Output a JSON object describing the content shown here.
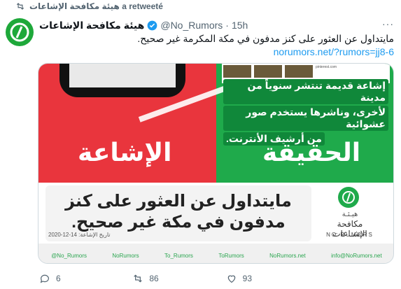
{
  "retweet": {
    "icon": "retweet-icon",
    "text": "هيئة مكافحة الإشاعات a retweeté"
  },
  "tweet": {
    "display_name": "هيئة مكافحة الإشاعات",
    "handle": "@No_Rumors",
    "dot": "·",
    "time": "15h",
    "more": "···",
    "text": "مايتداول عن العثور على كنز مدفون في مكة المكرمة غير صحيح.",
    "link": "norumors.net/?rumors=jj8-6"
  },
  "media": {
    "thumb_text": "pinterest.com",
    "rumor_lines": [
      "إشاعة قديمة تنتشر سنوياً من مدينة",
      "لأخرى، وناشرها يستخدم صور عشوائية",
      "من أرشيف الأنترنت."
    ],
    "label_fact": "الحقيقة",
    "label_rumor": "الإشاعة",
    "headline": "مايتداول عن العثور على كنز مدفون في مكة غير صحيح.",
    "date": "تاريخ الإشاعة: 14-12-2020",
    "logo_top": "هيـئـة",
    "logo_arabic": "مكافحة الإشـاعات",
    "logo_latin": "NO RUMORS",
    "social": [
      "@No_Rumors",
      "NoRumors",
      "To_Rumors",
      "ToRumors",
      "NoRumors.net",
      "info@NoRumors.net"
    ]
  },
  "actions": {
    "reply_count": "6",
    "retweet_count": "86",
    "like_count": "93"
  },
  "colors": {
    "brand_green": "#1faa4b",
    "rumor_red": "#e9353d",
    "link_blue": "#1d9bf0",
    "muted": "#536471"
  }
}
